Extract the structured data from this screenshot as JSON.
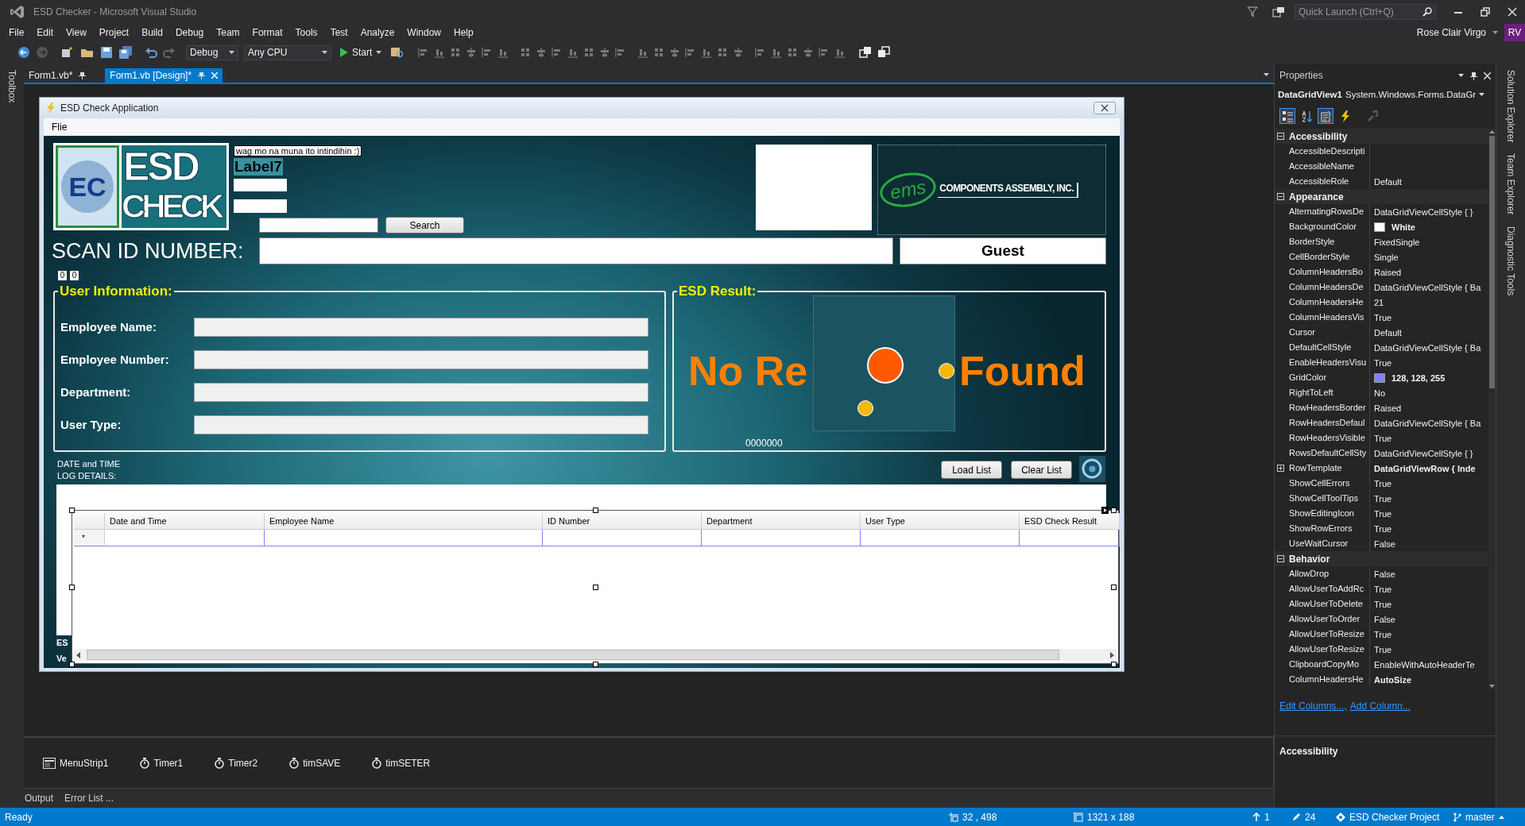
{
  "window": {
    "title": "ESD Checker - Microsoft Visual Studio",
    "quick_launch": {
      "placeholder": "Quick Launch (Ctrl+Q)"
    },
    "user_name": "Rose Clair Virgo",
    "user_initials": "RV"
  },
  "menu": [
    "File",
    "Edit",
    "View",
    "Project",
    "Build",
    "Debug",
    "Team",
    "Format",
    "Tools",
    "Test",
    "Analyze",
    "Window",
    "Help"
  ],
  "toolbar": {
    "configuration": "Debug",
    "platform": "Any CPU",
    "start": "Start"
  },
  "toolbox_tab": "Toolbox",
  "doc_tabs": [
    {
      "label": "Form1.vb*",
      "selected": false
    },
    {
      "label": "Form1.vb [Design]*",
      "selected": true
    }
  ],
  "form": {
    "title": "ESD Check Application",
    "menu": [
      "Flie"
    ],
    "logo": {
      "initials": "EC",
      "title": "ESD",
      "subtitle": "CHECK"
    },
    "note": "wag mo na muna ito intindihin :)",
    "label7": "Label7",
    "search_button": "Search",
    "company_logo": {
      "mark": "ems",
      "name": "COMPONENTS ASSEMBLY, INC."
    },
    "scan_label": "SCAN ID NUMBER:",
    "guest_button": "Guest",
    "counters": [
      "0",
      "0"
    ],
    "user_info": {
      "title": "User Information:",
      "fields": [
        "Employee Name:",
        "Employee Number:",
        "Department:",
        "User Type:"
      ]
    },
    "esd_result": {
      "title": "ESD Result:",
      "message_start": "No Re",
      "message_end": "Found",
      "code": "0000000"
    },
    "log_label": [
      "DATE and TIME",
      "LOG DETAILS:"
    ],
    "load_button": "Load List",
    "clear_button": "Clear List",
    "cut_labels": [
      "ES",
      "Ve"
    ],
    "grid": {
      "columns": [
        "Date and Time",
        "Employee Name",
        "ID Number",
        "Department",
        "User Type",
        "ESD Check Result"
      ],
      "new_row_marker": "*"
    }
  },
  "tray": [
    {
      "kind": "menustrip",
      "label": "MenuStrip1"
    },
    {
      "kind": "timer",
      "label": "Timer1"
    },
    {
      "kind": "timer",
      "label": "Timer2"
    },
    {
      "kind": "timer",
      "label": "timSAVE"
    },
    {
      "kind": "timer",
      "label": "timSETER"
    }
  ],
  "bottom_tabs": [
    "Output",
    "Error List ..."
  ],
  "properties": {
    "title": "Properties",
    "object_name": "DataGridView1",
    "object_type": "System.Windows.Forms.DataGr",
    "view_buttons": [
      {
        "kind": "categorized",
        "selected": true,
        "disabled": false
      },
      {
        "kind": "alphabetical",
        "selected": false,
        "disabled": false
      },
      {
        "kind": "properties",
        "selected": true,
        "disabled": false
      },
      {
        "kind": "events",
        "selected": false,
        "disabled": false
      },
      {
        "kind": "property_pages",
        "selected": false,
        "disabled": true
      }
    ],
    "categories": [
      {
        "name": "Accessibility",
        "expanded": true,
        "rows": [
          {
            "name": "AccessibleDescripti",
            "kind": "text",
            "modified": false
          },
          {
            "name": "AccessibleName",
            "kind": "text",
            "modified": false
          },
          {
            "name": "AccessibleRole",
            "value": "Default",
            "kind": "text",
            "modified": false
          }
        ]
      },
      {
        "name": "Appearance",
        "expanded": true,
        "rows": [
          {
            "name": "AlternatingRowsDe",
            "value": "DataGridViewCellStyle { }",
            "kind": "text",
            "modified": false
          },
          {
            "name": "BackgroundColor",
            "value": "White",
            "kind": "color",
            "color": "#ffffff",
            "modified": true
          },
          {
            "name": "BorderStyle",
            "value": "FixedSingle",
            "kind": "text",
            "modified": false
          },
          {
            "name": "CellBorderStyle",
            "value": "Single",
            "kind": "text",
            "modified": false
          },
          {
            "name": "ColumnHeadersBo",
            "value": "Raised",
            "kind": "text",
            "modified": false
          },
          {
            "name": "ColumnHeadersDe",
            "value": "DataGridViewCellStyle { Ba",
            "kind": "text",
            "modified": false
          },
          {
            "name": "ColumnHeadersHe",
            "value": "21",
            "kind": "text",
            "modified": false
          },
          {
            "name": "ColumnHeadersVis",
            "value": "True",
            "kind": "text",
            "modified": false
          },
          {
            "name": "Cursor",
            "value": "Default",
            "kind": "text",
            "modified": false
          },
          {
            "name": "DefaultCellStyle",
            "value": "DataGridViewCellStyle { Ba",
            "kind": "text",
            "modified": false
          },
          {
            "name": "EnableHeadersVisu",
            "value": "True",
            "kind": "text",
            "modified": false
          },
          {
            "name": "GridColor",
            "value": "128, 128, 255",
            "kind": "color",
            "color": "#8080ff",
            "modified": true
          },
          {
            "name": "RightToLeft",
            "value": "No",
            "kind": "text",
            "modified": false
          },
          {
            "name": "RowHeadersBorder",
            "value": "Raised",
            "kind": "text",
            "modified": false
          },
          {
            "name": "RowHeadersDefaul",
            "value": "DataGridViewCellStyle { Ba",
            "kind": "text",
            "modified": false
          },
          {
            "name": "RowHeadersVisible",
            "value": "True",
            "kind": "text",
            "modified": false
          },
          {
            "name": "RowsDefaultCellSty",
            "value": "DataGridViewCellStyle { }",
            "kind": "text",
            "modified": false
          },
          {
            "name": "RowTemplate",
            "value": "DataGridViewRow { Inde",
            "kind": "expandable",
            "modified": true
          },
          {
            "name": "ShowCellErrors",
            "value": "True",
            "kind": "text",
            "modified": false
          },
          {
            "name": "ShowCellToolTips",
            "value": "True",
            "kind": "text",
            "modified": false
          },
          {
            "name": "ShowEditingIcon",
            "value": "True",
            "kind": "text",
            "modified": false
          },
          {
            "name": "ShowRowErrors",
            "value": "True",
            "kind": "text",
            "modified": false
          },
          {
            "name": "UseWaitCursor",
            "value": "False",
            "kind": "text",
            "modified": false
          }
        ]
      },
      {
        "name": "Behavior",
        "expanded": true,
        "rows": [
          {
            "name": "AllowDrop",
            "value": "False",
            "kind": "text",
            "modified": false
          },
          {
            "name": "AllowUserToAddRc",
            "value": "True",
            "kind": "text",
            "modified": false
          },
          {
            "name": "AllowUserToDelete",
            "value": "True",
            "kind": "text",
            "modified": false
          },
          {
            "name": "AllowUserToOrder",
            "value": "False",
            "kind": "text",
            "modified": false
          },
          {
            "name": "AllowUserToResize",
            "value": "True",
            "kind": "text",
            "modified": false
          },
          {
            "name": "AllowUserToResize",
            "value": "True",
            "kind": "text",
            "modified": false
          },
          {
            "name": "ClipboardCopyMo",
            "value": "EnableWithAutoHeaderTe",
            "kind": "text",
            "modified": false
          },
          {
            "name": "ColumnHeadersHe",
            "value": "AutoSize",
            "kind": "text",
            "modified": true
          }
        ]
      }
    ],
    "links": [
      "Edit Columns...,",
      "Add Column..."
    ],
    "description_title": "Accessibility"
  },
  "side_tabs": [
    "Solution Explorer",
    "Team Explorer",
    "Diagnostic Tools"
  ],
  "status_bar": {
    "state": "Ready",
    "position": "32 , 498",
    "size": "1321 x 188",
    "publish_count": "1",
    "changes": "24",
    "project": "ESD Checker Project",
    "branch": "master"
  }
}
